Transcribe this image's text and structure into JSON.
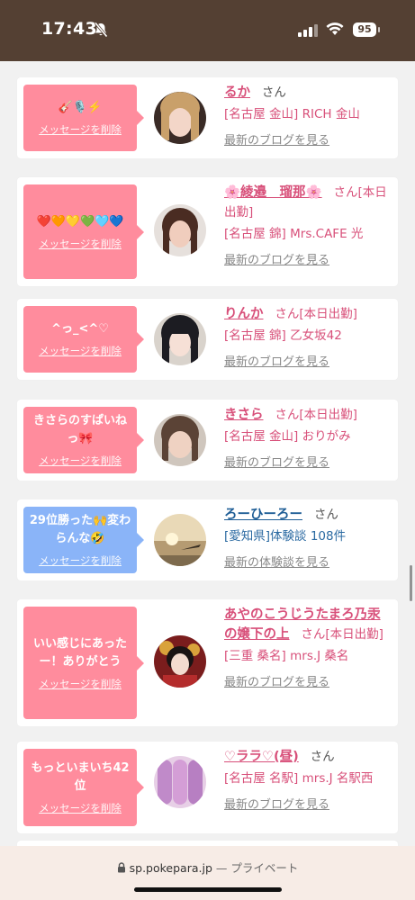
{
  "status_bar": {
    "time": "17:43",
    "battery": "95"
  },
  "browser": {
    "url": "sp.pokepara.jp",
    "separator": "—",
    "mode": "プライベート"
  },
  "cards": [
    {
      "message": "🎸🎙️⚡️",
      "delete_label": "メッセージを削除",
      "name": "るか",
      "suffix": "さん",
      "shop": "[名古屋 金山] RICH 金山",
      "link": "最新のブログを見る"
    },
    {
      "message": "❤️🧡💛💚🩵💙",
      "delete_label": "メッセージを削除",
      "name": "🌸綾邉　瑠那🌸",
      "suffix": "さん[本日出勤]",
      "shop": "[名古屋 錦] Mrs.CAFE 光",
      "link": "最新のブログを見る"
    },
    {
      "message": "^っ_<^♡",
      "delete_label": "メッセージを削除",
      "name": "りんか",
      "suffix": "さん[本日出勤]",
      "shop": "[名古屋 錦] 乙女坂42",
      "link": "最新のブログを見る"
    },
    {
      "message": "きさらのすぱいねっ🎀",
      "delete_label": "メッセージを削除",
      "name": "きさら",
      "suffix": "さん[本日出勤]",
      "shop": "[名古屋 金山] おりがみ",
      "link": "最新のブログを見る"
    },
    {
      "message": "29位勝った🙌変わらんな🤣",
      "delete_label": "メッセージを削除",
      "name": "ろーひーろー",
      "suffix": "さん",
      "shop": "[愛知県]体験談 108件",
      "link": "最新の体験談を見る"
    },
    {
      "message": "いい感じにあったー！ありがとう",
      "delete_label": "メッセージを削除",
      "name": "あやのこうじうたまろ乃汞の嬢下の上",
      "suffix": "さん[本日出勤]",
      "shop": "[三重 桑名] mrs.J 桑名",
      "link": "最新のブログを見る"
    },
    {
      "message": "もっといまいち42位",
      "delete_label": "メッセージを削除",
      "name": "♡ララ♡(昼)",
      "suffix": "さん",
      "shop": "[名古屋 名駅] mrs.J 名駅西",
      "link": "最新のブログを見る"
    }
  ],
  "colors": {
    "pink_bubble": "#ff8c9d",
    "blue_bubble": "#8ab4f8",
    "name_pink": "#d8507a",
    "name_blue": "#1f5e96",
    "status_bar": "#544033"
  }
}
